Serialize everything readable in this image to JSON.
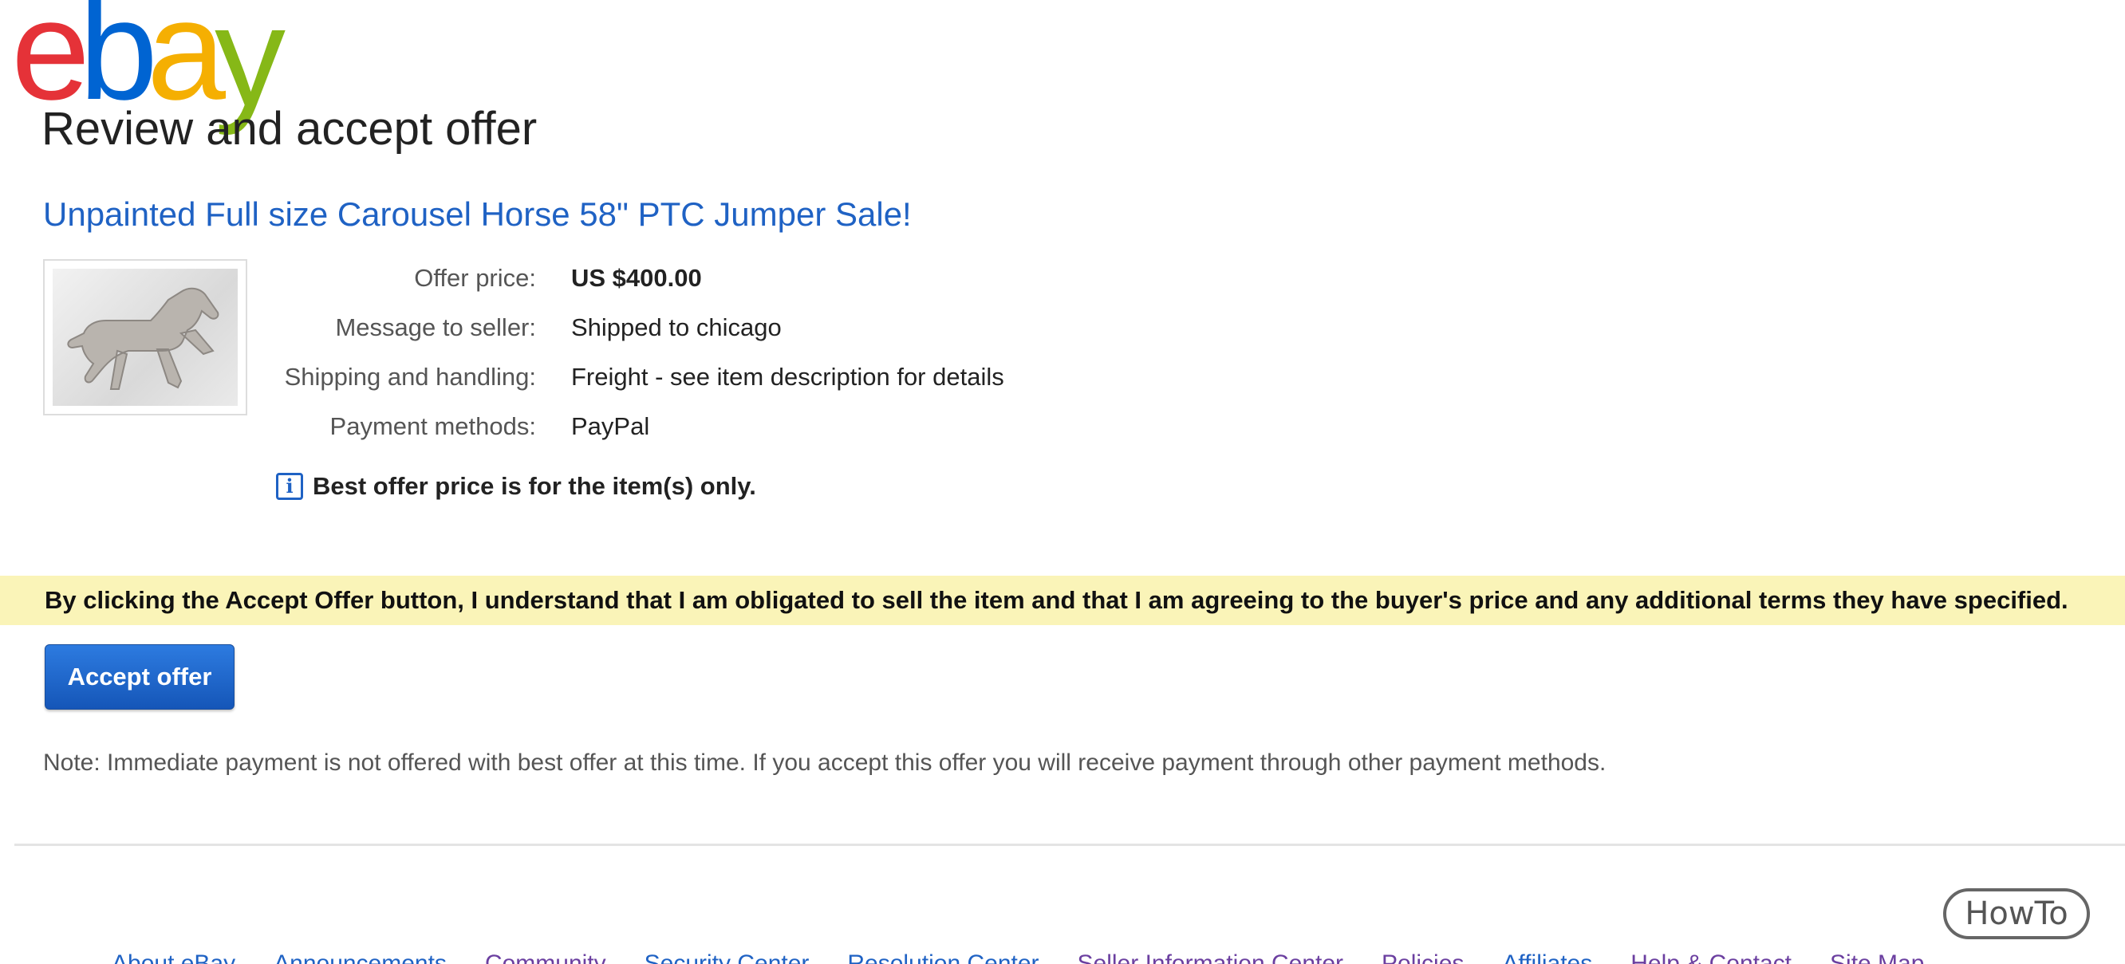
{
  "logo": {
    "letters": [
      "e",
      "b",
      "a",
      "y"
    ],
    "colors": [
      "#e53238",
      "#0064d2",
      "#f5af02",
      "#86b817"
    ]
  },
  "page_title": "Review and accept offer",
  "item": {
    "title": "Unpainted Full size Carousel Horse 58\" PTC Jumper Sale!",
    "thumbnail_icon": "carousel-horse-image"
  },
  "details": [
    {
      "label": "Offer price:",
      "value": "US $400.00"
    },
    {
      "label": "Message to seller:",
      "value": "Shipped to chicago"
    },
    {
      "label": "Shipping and handling:",
      "value": "Freight - see item description for details"
    },
    {
      "label": "Payment methods:",
      "value": "PayPal"
    }
  ],
  "info_note": {
    "icon": "info-icon",
    "glyph": "i",
    "text": "Best offer price is for the item(s) only."
  },
  "terms": "By clicking the Accept Offer button, I understand that I am obligated to sell the item and that I am agreeing to the buyer's price and any additional terms they have specified.",
  "accept_button": "Accept offer",
  "note": "Note: Immediate payment is not offered with best offer at this time. If you accept this offer you will receive payment through other payment methods.",
  "watermark": "HowTo",
  "footer": {
    "links": [
      "About eBay",
      "Announcements",
      "Community",
      "Security Center",
      "Resolution Center",
      "Seller Information Center",
      "Policies",
      "Affiliates",
      "Help & Contact",
      "Site Map"
    ]
  },
  "colors": {
    "link": "#1f62c4",
    "visited_link": "#6b3fa0",
    "terms_background": "#faf4b8",
    "button": "#1f66c9"
  }
}
